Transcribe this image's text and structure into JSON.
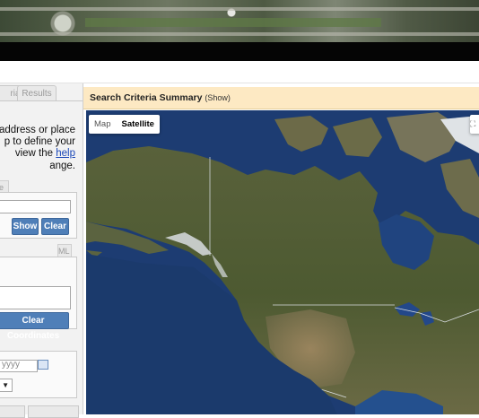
{
  "left_panel": {
    "tabs": [
      {
        "label": "ria",
        "active": false
      },
      {
        "label": "Results",
        "active": false
      }
    ],
    "instructions": {
      "line1": "address or place",
      "line2": "p to define your",
      "line3_prefix": "view the ",
      "help_link": "help",
      "line4": "ange."
    },
    "address_tab_label": "e",
    "show_button": "Show",
    "clear_button": "Clear",
    "kml_tab_label": "ML",
    "clear_coordinates_button": "Clear Coordinates",
    "date_placeholder": "yyyy",
    "select_arrow": "▼"
  },
  "search_summary": {
    "title": "Search Criteria Summary",
    "toggle": "(Show)"
  },
  "map": {
    "type_controls": [
      "Map",
      "Satellite"
    ],
    "active_type": "Satellite",
    "fullscreen_icon": "fullscreen-icon"
  }
}
